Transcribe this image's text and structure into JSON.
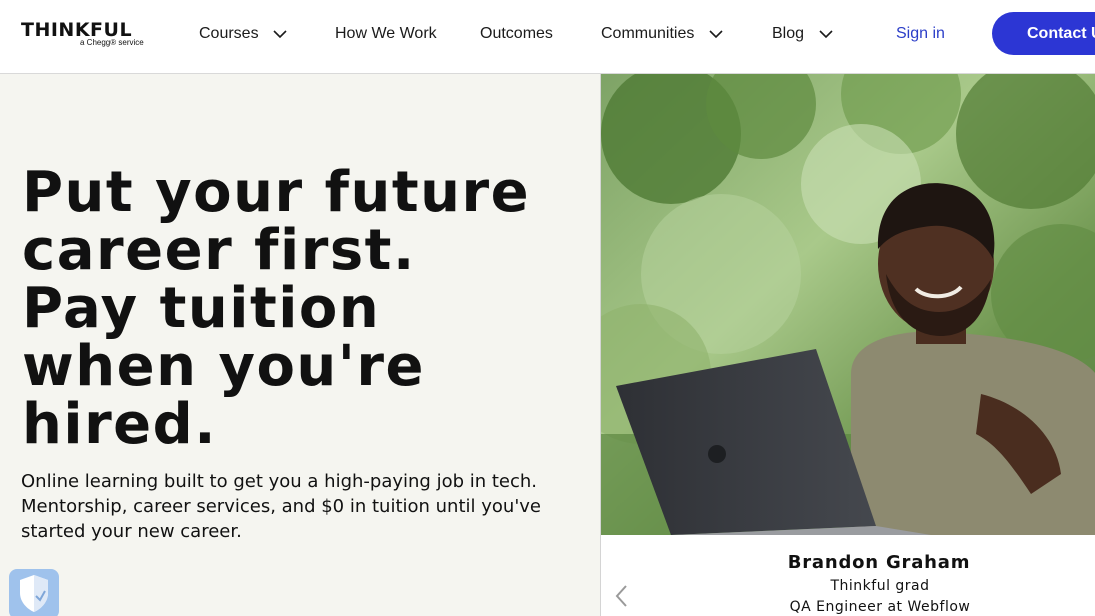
{
  "header": {
    "logo": {
      "name": "THINKFUL",
      "tagline": "a Chegg® service"
    },
    "nav": [
      {
        "label": "Courses",
        "has_dropdown": true,
        "icon": "chevron-down-icon"
      },
      {
        "label": "How We Work",
        "has_dropdown": false
      },
      {
        "label": "Outcomes",
        "has_dropdown": false
      },
      {
        "label": "Communities",
        "has_dropdown": true,
        "icon": "chevron-down-icon"
      },
      {
        "label": "Blog",
        "has_dropdown": true,
        "icon": "chevron-down-icon"
      }
    ],
    "signin_label": "Sign in",
    "contact_label": "Contact Us"
  },
  "hero": {
    "headline_lines": [
      "Put your future",
      "career first.",
      "Pay tuition",
      "when you're",
      "hired."
    ],
    "subtext": "Online learning built to get you a high-paying job in tech. Mentorship, career services, and $0 in tuition until you've started your new career."
  },
  "testimonial": {
    "name": "Brandon Graham",
    "line1": "Thinkful grad",
    "line2": "QA Engineer at Webflow",
    "prev_icon": "chevron-left-icon"
  },
  "privacy_badge": {
    "icon": "shield-check-icon"
  },
  "colors": {
    "accent": "#2c36d4",
    "link": "#2b3ec8",
    "hero_bg": "#f5f5f0",
    "badge_bg": "#9fc2ec"
  }
}
